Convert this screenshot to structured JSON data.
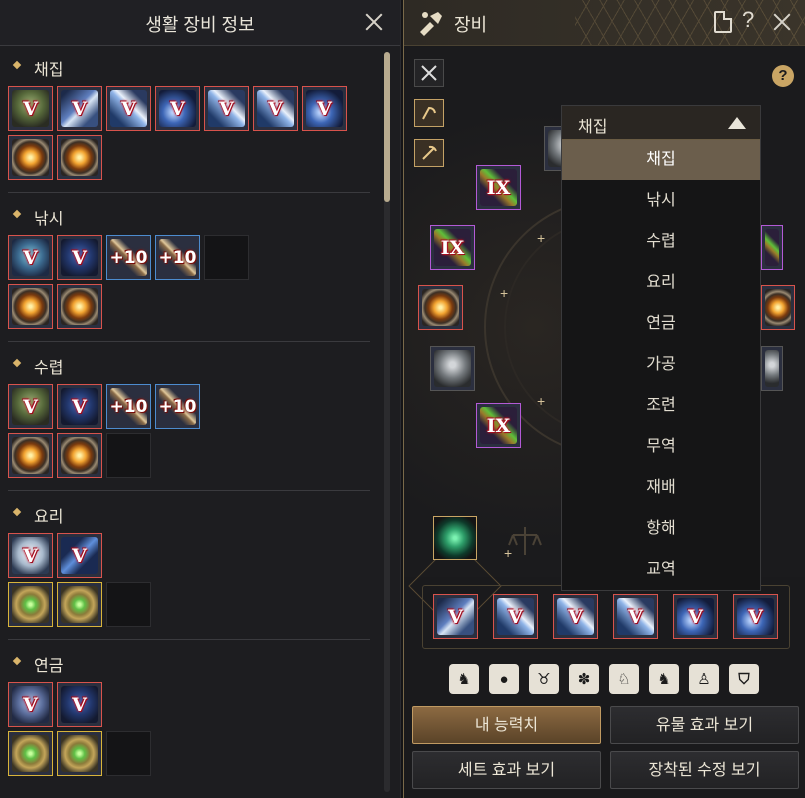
{
  "left_panel": {
    "title": "생활 장비 정보",
    "sections": [
      {
        "label": "채집"
      },
      {
        "label": "낚시"
      },
      {
        "label": "수렵"
      },
      {
        "label": "요리"
      },
      {
        "label": "연금"
      }
    ],
    "badges": {
      "v": "V",
      "plus10": "+10",
      "ix": "IX"
    }
  },
  "right_panel": {
    "title": "장비",
    "dropdown": {
      "selected": "채집",
      "options": [
        "채집",
        "낚시",
        "수렵",
        "요리",
        "연금",
        "가공",
        "조련",
        "무역",
        "재배",
        "항해",
        "교역"
      ]
    },
    "help_label": "?",
    "buttons": {
      "my_stats": "내 능력치",
      "relic_effect": "유물 효과 보기",
      "set_effect": "세트 효과 보기",
      "crystal": "장착된 수정 보기"
    }
  },
  "colors": {
    "accent": "#c9a564",
    "slot_red": "#d8534c",
    "slot_blue": "#4d8ccf",
    "slot_gold": "#d8b43a",
    "slot_purple": "#b35ad6"
  }
}
